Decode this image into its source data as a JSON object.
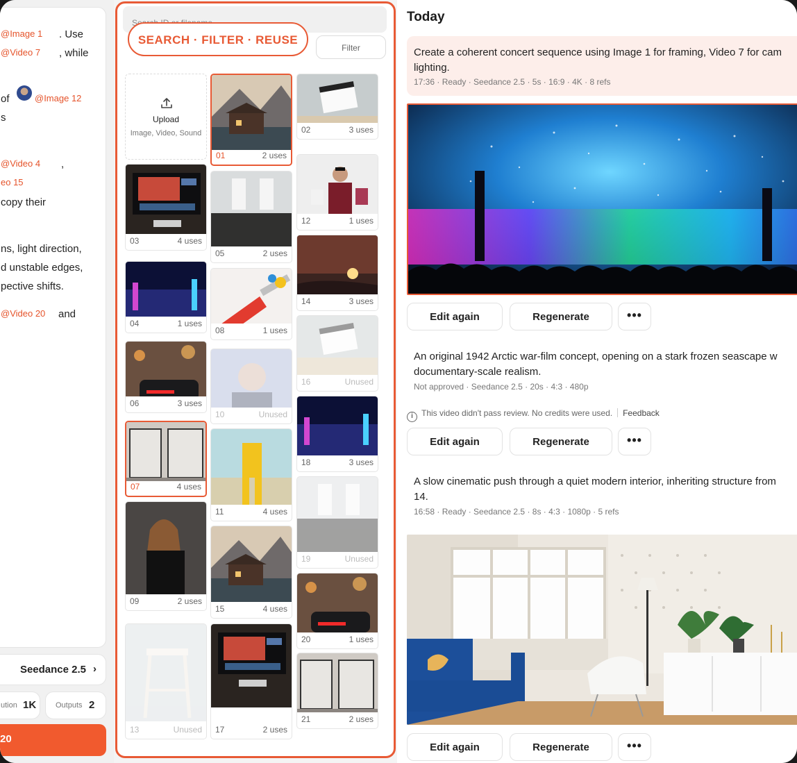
{
  "prompt": {
    "lines": [
      {
        "mention": "@Image 1",
        "text": ". Use"
      },
      {
        "mention": "@Video 7",
        "text": ", while"
      },
      {
        "prefix": "of",
        "mention": "@Image 12"
      },
      {
        "text": "s"
      },
      {
        "mention": "@Video 4",
        "text": ","
      },
      {
        "mention": "eo 15"
      },
      {
        "text": "copy their"
      },
      {
        "text": "ns, light direction,"
      },
      {
        "text": "d unstable edges,"
      },
      {
        "text": "pective shifts."
      },
      {
        "mention": "@Video 20",
        "text": "and"
      }
    ]
  },
  "model": {
    "name": "Seedance 2.5",
    "chevron": "›"
  },
  "options": {
    "resolution_label": "ution",
    "resolution_value": "1K",
    "outputs_label": "Outputs",
    "outputs_value": "2"
  },
  "generate_button": {
    "label": "20"
  },
  "library": {
    "search_placeholder": "Search ID or filename...",
    "banner": "SEARCH · FILTER · REUSE",
    "filter_label": "Filter",
    "upload": {
      "title": "Upload",
      "subtitle": "Image, Video, Sound",
      "icon": "upload-icon"
    },
    "tiles": [
      {
        "id": "01",
        "uses": "2 uses",
        "selected": true,
        "scene": "lake-house"
      },
      {
        "id": "02",
        "uses": "3 uses",
        "scene": "clapperboard"
      },
      {
        "id": "03",
        "uses": "4 uses",
        "scene": "editing-desk"
      },
      {
        "id": "05",
        "uses": "2 uses",
        "scene": "theater-crowd"
      },
      {
        "id": "12",
        "uses": "1 uses",
        "scene": "shopping-woman"
      },
      {
        "id": "04",
        "uses": "1 uses",
        "scene": "neon-street"
      },
      {
        "id": "08",
        "uses": "1 uses",
        "scene": "paint-brush"
      },
      {
        "id": "14",
        "uses": "3 uses",
        "scene": "sunset"
      },
      {
        "id": "06",
        "uses": "3 uses",
        "scene": "red-car"
      },
      {
        "id": "10",
        "uses": "Unused",
        "faded": true,
        "scene": "portrait-blue"
      },
      {
        "id": "16",
        "uses": "Unused",
        "faded": true,
        "scene": "clapperboard"
      },
      {
        "id": "07",
        "uses": "4 uses",
        "selected": true,
        "scene": "office-glass"
      },
      {
        "id": "11",
        "uses": "4 uses",
        "scene": "yellow-suit"
      },
      {
        "id": "18",
        "uses": "3 uses",
        "scene": "neon-street"
      },
      {
        "id": "09",
        "uses": "2 uses",
        "scene": "woman-portrait"
      },
      {
        "id": "19",
        "uses": "Unused",
        "faded": true,
        "scene": "theater-crowd"
      },
      {
        "id": "15",
        "uses": "4 uses",
        "scene": "lake-house"
      },
      {
        "id": "20",
        "uses": "1 uses",
        "scene": "red-car"
      },
      {
        "id": "13",
        "uses": "Unused",
        "faded": true,
        "scene": "stool"
      },
      {
        "id": "17",
        "uses": "2 uses",
        "scene": "editing-desk"
      },
      {
        "id": "21",
        "uses": "2 uses",
        "scene": "office-glass"
      }
    ]
  },
  "history": {
    "section_title": "Today",
    "items": [
      {
        "prompt_line1": "Create a coherent concert sequence using Image 1 for framing, Video 7 for cam",
        "prompt_line2": "lighting.",
        "meta": "17:36 · Ready · Seedance 2.5 · 5s · 16:9 · 4K · 8 refs"
      },
      {
        "prompt_line1": "An original 1942 Arctic war-film concept, opening on a stark frozen seascape w",
        "prompt_line2": "documentary-scale realism.",
        "meta": "Not approved · Seedance 2.5 · 20s · 4:3 · 480p",
        "warning": "This video didn't pass review. No credits were used.",
        "feedback": "Feedback"
      },
      {
        "prompt_line1": "A slow cinematic push through a quiet modern interior, inheriting structure from",
        "prompt_line2": "14.",
        "meta": "16:58 · Ready · Seedance 2.5 · 8s · 4:3 · 1080p · 5 refs"
      }
    ],
    "actions": {
      "edit": "Edit again",
      "regenerate": "Regenerate",
      "more": "•••"
    }
  },
  "colors": {
    "accent": "#e85a35",
    "generate": "#f15a2e",
    "request_bg": "#fdeeea"
  }
}
